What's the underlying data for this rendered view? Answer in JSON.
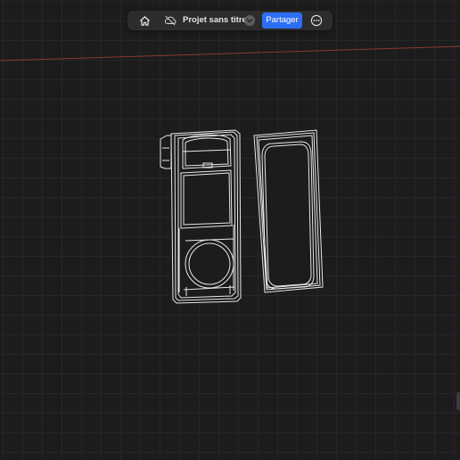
{
  "toolbar": {
    "home_icon": "home-icon",
    "cloud_icon": "cloud-offline-icon",
    "project_title": "Projet sans titre",
    "title_menu_icon": "chevron-down-icon",
    "share_label": "Partager",
    "more_icon": "more-options-icon"
  },
  "colors": {
    "canvas_background": "#1c1c1d",
    "grid_line": "#262628",
    "toolbar_background": "#2c2c2e",
    "accent": "#2d6ef6",
    "ground_axis": "#8a3a2e",
    "model_stroke": "#e8e8e8"
  },
  "scene": {
    "objects": [
      "main-housing-part",
      "frame-part"
    ]
  }
}
